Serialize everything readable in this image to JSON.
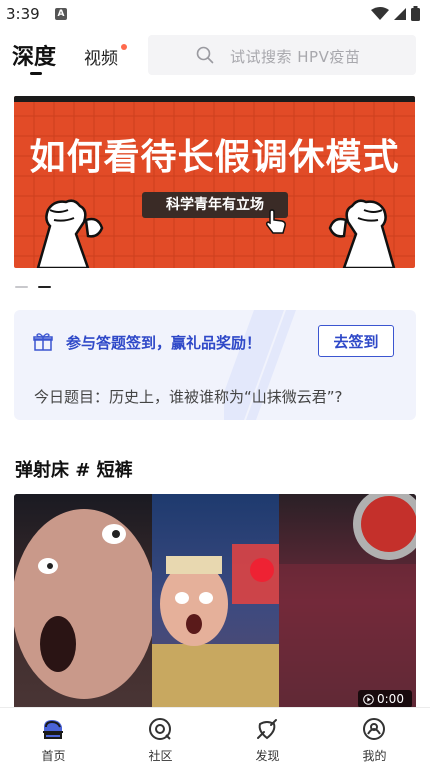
{
  "status_bar": {
    "time": "3:39",
    "notif_letter": "A"
  },
  "header": {
    "tab_deep": "深度",
    "tab_video": "视频",
    "search_placeholder": "试试搜索 HPV疫苗"
  },
  "banner": {
    "title": "如何看待长假调休模式",
    "subtitle": "科学青年有立场",
    "colors": {
      "background": "#e24b27",
      "sub_bg": "#3a2b26"
    }
  },
  "carousel": {
    "page": 2,
    "total": 2
  },
  "signin": {
    "title": "参与答题签到，赢礼品奖励！",
    "button_label": "去签到",
    "question": "今日题目：历史上，谁被谁称为“山抹微云君”?"
  },
  "section": {
    "title": "弹射床 # 短裤"
  },
  "video": {
    "duration": "0:00"
  },
  "bottom_nav": {
    "items": [
      {
        "label": "首页",
        "icon": "home-icon",
        "active": true
      },
      {
        "label": "社区",
        "icon": "community-icon",
        "active": false
      },
      {
        "label": "发现",
        "icon": "discover-icon",
        "active": false
      },
      {
        "label": "我的",
        "icon": "profile-icon",
        "active": false
      }
    ]
  },
  "colors": {
    "accent": "#2f49c8",
    "active_nav": "#4a63d8"
  }
}
